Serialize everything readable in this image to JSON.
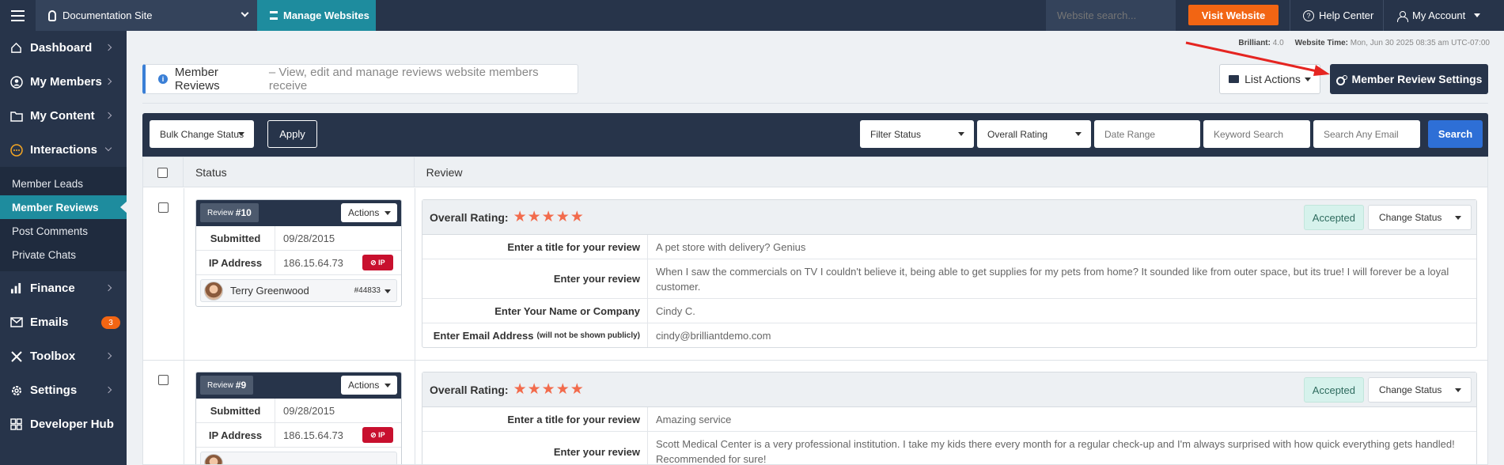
{
  "topbar": {
    "site": "Documentation Site",
    "manage": "Manage Websites",
    "search_placeholder": "Website search...",
    "visit": "Visit Website",
    "help": "Help Center",
    "account": "My Account"
  },
  "sidebar": {
    "items": [
      {
        "label": "Dashboard"
      },
      {
        "label": "My Members"
      },
      {
        "label": "My Content"
      },
      {
        "label": "Interactions"
      },
      {
        "label": "Finance"
      },
      {
        "label": "Emails",
        "badge": "3"
      },
      {
        "label": "Toolbox"
      },
      {
        "label": "Settings"
      },
      {
        "label": "Developer Hub"
      }
    ],
    "sub": [
      "Member Leads",
      "Member Reviews",
      "Post Comments",
      "Private Chats"
    ]
  },
  "meta": {
    "version_label": "Brilliant:",
    "version": "4.0",
    "time_label": "Website Time:",
    "time": "Mon, Jun 30 2025 08:35 am UTC-07:00"
  },
  "header": {
    "title": "Member Reviews",
    "desc": "– View, edit and manage reviews website members receive",
    "list_actions": "List Actions",
    "settings": "Member Review Settings"
  },
  "toolbar": {
    "bulk": "Bulk Change Status",
    "apply": "Apply",
    "filter_status": "Filter Status",
    "overall_rating": "Overall Rating",
    "date_range": "Date Range",
    "keyword": "Keyword Search",
    "email": "Search Any Email",
    "search": "Search"
  },
  "table": {
    "col_status": "Status",
    "col_review": "Review",
    "labels": {
      "review": "Review",
      "actions": "Actions",
      "submitted": "Submitted",
      "ip": "IP Address",
      "ip_btn": "IP",
      "overall": "Overall Rating:",
      "change_status": "Change Status",
      "title_q": "Enter a title for your review",
      "review_q": "Enter your review",
      "name_q": "Enter Your Name or Company",
      "email_q": "Enter Email Address",
      "email_note": "(will not be shown publicly)"
    },
    "reviews": [
      {
        "num": "#10",
        "submitted": "09/28/2015",
        "ip": "186.15.64.73",
        "member": "Terry Greenwood",
        "member_id": "#44833",
        "stars": "★★★★★",
        "status": "Accepted",
        "title": "A pet store with delivery? Genius",
        "review": "When I saw the commercials on TV I couldn't believe it, being able to get supplies for my pets from home? It sounded like from outer space, but its true! I will forever be a loyal customer.",
        "name": "Cindy C.",
        "email": "cindy@brilliantdemo.com"
      },
      {
        "num": "#9",
        "submitted": "09/28/2015",
        "ip": "186.15.64.73",
        "stars": "★★★★★",
        "status": "Accepted",
        "title": "Amazing service",
        "review": "Scott Medical Center is a very professional institution. I take my kids there every month for a regular check-up and I'm always surprised with how quick everything gets handled! Recommended for sure!"
      }
    ]
  }
}
